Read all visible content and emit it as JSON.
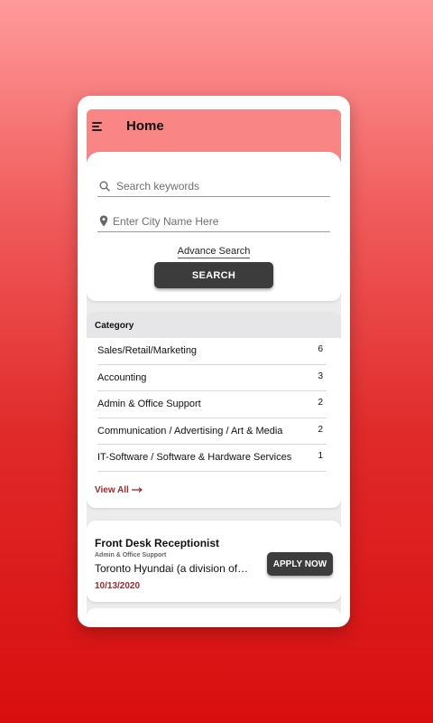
{
  "header": {
    "title": "Home",
    "menu_icon": "hamburger-icon",
    "background_color": "#f98585"
  },
  "search": {
    "keywords_placeholder": "Search keywords",
    "keywords_icon": "search-icon",
    "city_placeholder": "Enter City Name Here",
    "city_icon": "location-pin-icon",
    "advance_label": "Advance Search",
    "button_label": "SEARCH"
  },
  "categories": {
    "title": "Category",
    "items": [
      {
        "name": "Sales/Retail/Marketing",
        "count": "6"
      },
      {
        "name": "Accounting",
        "count": "3"
      },
      {
        "name": "Admin & Office Support",
        "count": "2"
      },
      {
        "name": "Communication / Advertising / Art & Media",
        "count": "2"
      },
      {
        "name": "IT-Software / Software & Hardware Services",
        "count": "1"
      }
    ],
    "view_all_label": "View All",
    "view_all_icon": "arrow-right-icon"
  },
  "job": {
    "title": "Front Desk Receptionist",
    "category": "Admin & Office Support",
    "company": "Toronto Hyundai (a division of M...",
    "date": "10/13/2020",
    "apply_label": "APPLY NOW"
  },
  "colors": {
    "accent": "#a02a2a",
    "button": "#3c3c3c",
    "background_top": "#ff9a9a",
    "background_bottom": "#d80e0e"
  }
}
